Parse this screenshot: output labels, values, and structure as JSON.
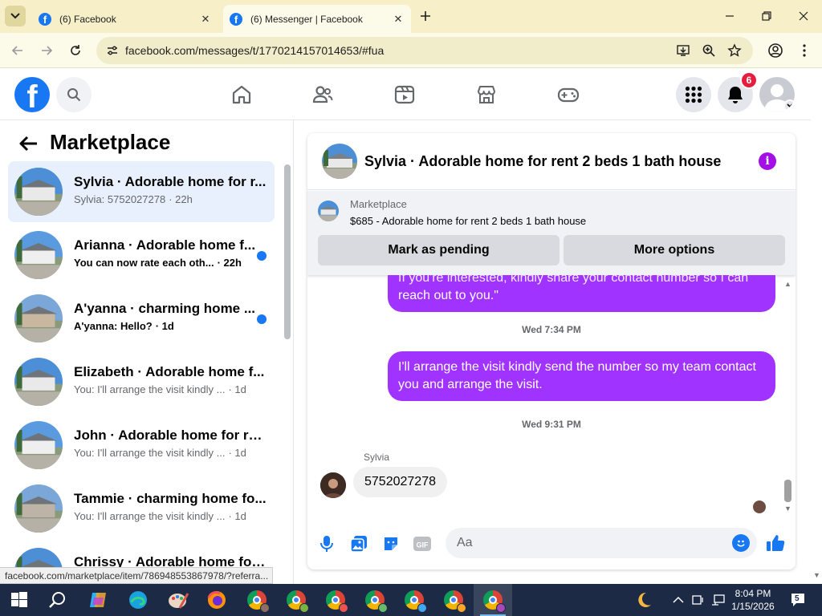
{
  "browser": {
    "tabs": [
      {
        "title": "(6) Facebook",
        "active": false
      },
      {
        "title": "(6) Messenger | Facebook",
        "active": true
      }
    ],
    "url": "facebook.com/messages/t/1770214157014653/#fua",
    "status_url": "facebook.com/marketplace/item/786948553867978/?referra..."
  },
  "fb": {
    "notification_count": "6",
    "icons": [
      "facebook-logo",
      "search-icon",
      "home-icon",
      "friends-icon",
      "video-icon",
      "marketplace-icon",
      "gaming-icon",
      "menu-grid-icon",
      "bell-icon",
      "profile-avatar"
    ]
  },
  "sidebar": {
    "title": "Marketplace",
    "conversations": [
      {
        "name": "Sylvia · Adorable home for r...",
        "preview": "Sylvia: 5752027278",
        "time": "· 22h",
        "unread": false,
        "selected": true
      },
      {
        "name": "Arianna · Adorable home f...",
        "preview": "You can now rate each oth...",
        "time": "· 22h",
        "unread": true,
        "selected": false
      },
      {
        "name": "A'yanna · charming home ...",
        "preview": "A'yanna: Hello?",
        "time": "· 1d",
        "unread": true,
        "selected": false
      },
      {
        "name": "Elizabeth · Adorable home f...",
        "preview": "You: I'll arrange the visit kindly ...",
        "time": "· 1d",
        "unread": false,
        "selected": false
      },
      {
        "name": "John · Adorable home for re...",
        "preview": "You: I'll arrange the visit kindly ...",
        "time": "· 1d",
        "unread": false,
        "selected": false
      },
      {
        "name": "Tammie · charming home fo...",
        "preview": "You: I'll arrange the visit kindly ...",
        "time": "· 1d",
        "unread": false,
        "selected": false
      },
      {
        "name": "Chrissy · Adorable home for ...",
        "preview": "",
        "time": "",
        "unread": false,
        "selected": false
      }
    ]
  },
  "chat": {
    "title": "Sylvia · Adorable home for rent 2 beds 1 bath house",
    "listing": {
      "label": "Marketplace",
      "description": "$685 - Adorable home for rent 2 beds 1 bath house",
      "mark_pending": "Mark as pending",
      "more_options": "More options"
    },
    "messages": {
      "out1_partial": "If you're interested, kindly share your contact number so I can",
      "out1_tail": "reach out to you.\"",
      "stamp1": "Wed 7:34 PM",
      "out2": "I'll arrange the visit kindly send the number so my team contact you and arrange the visit.",
      "stamp2": "Wed 9:31 PM",
      "sender": "Sylvia",
      "in1": "5752027278"
    },
    "composer": {
      "placeholder": "Aa"
    }
  },
  "taskbar": {
    "time": "8:04 PM",
    "date": "1/15/2026",
    "notifications": "5"
  },
  "colors": {
    "accent": "#1877f2",
    "outgoing_bubble": "#a033ff",
    "info": "#a40fe8",
    "chrome_frame": "#f6efc8"
  }
}
